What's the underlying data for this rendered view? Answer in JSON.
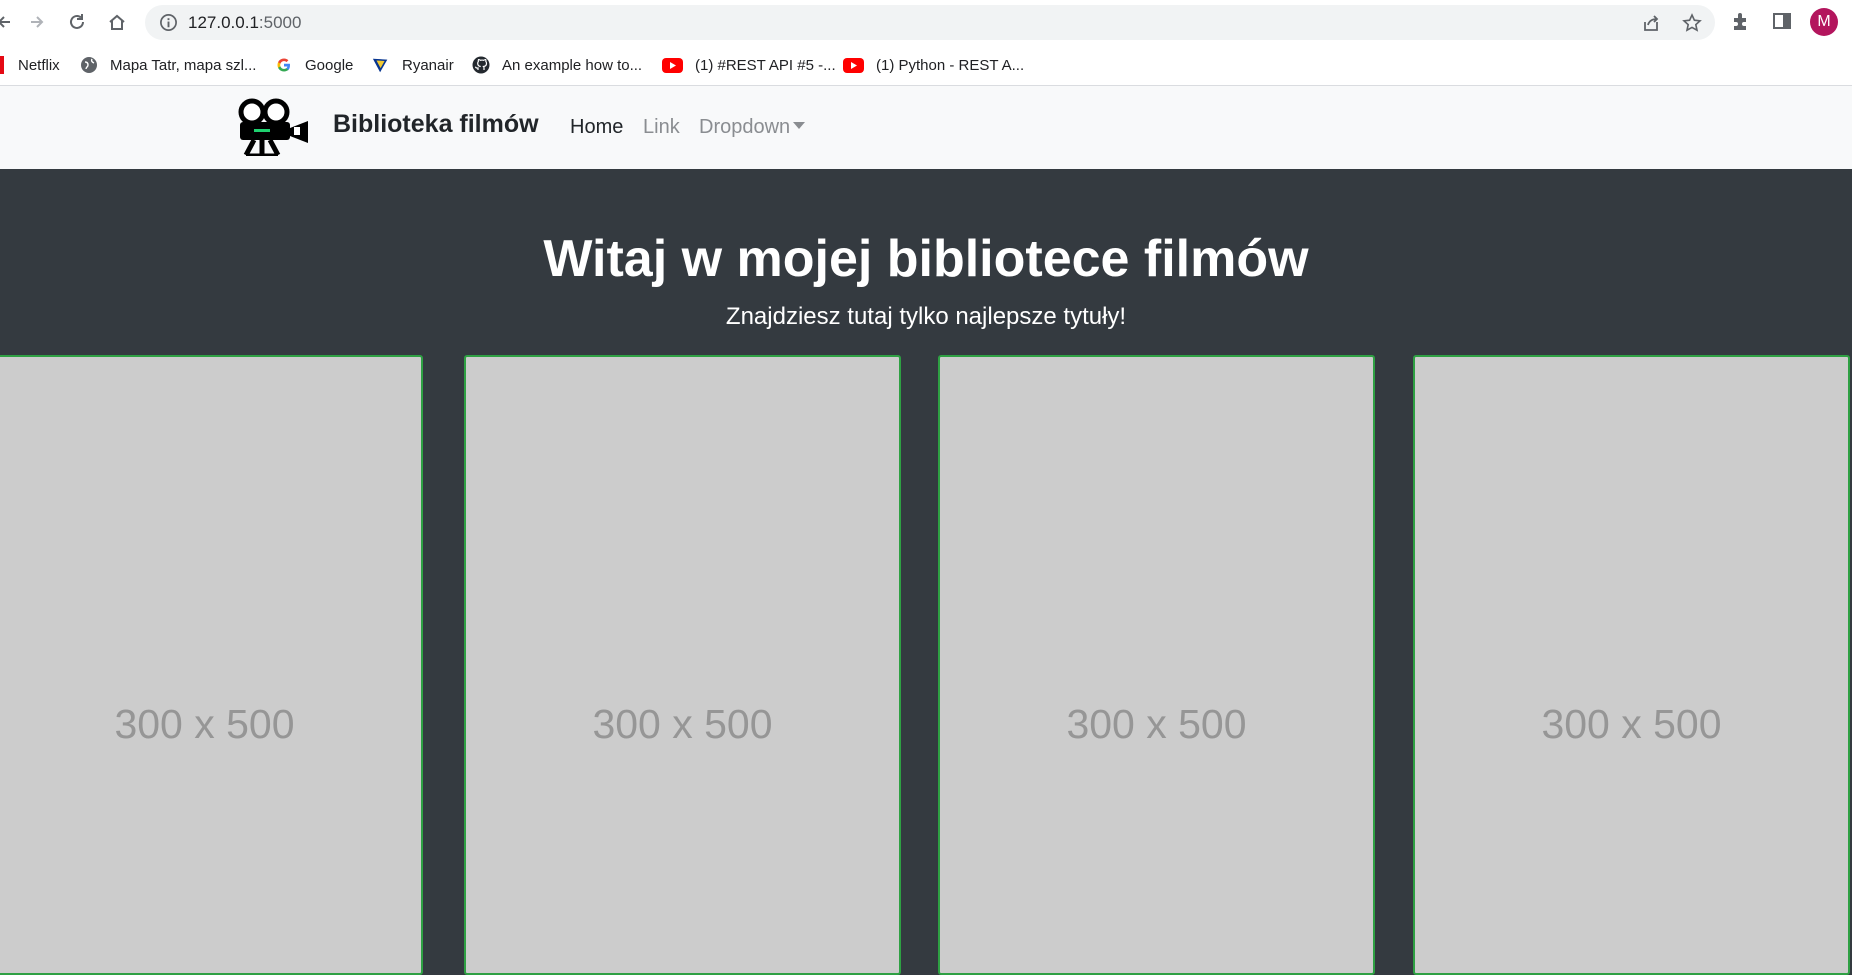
{
  "browser": {
    "url_host": "127.0.0.1",
    "url_port": ":5000",
    "avatar_letter": "M",
    "bookmarks": [
      {
        "label": "Netflix",
        "icon": "netflix-icon"
      },
      {
        "label": "Mapa Tatr, mapa szl...",
        "icon": "globe-icon"
      },
      {
        "label": "Google",
        "icon": "google-icon"
      },
      {
        "label": "Ryanair",
        "icon": "ryanair-icon"
      },
      {
        "label": "An example how to...",
        "icon": "github-icon"
      },
      {
        "label": "(1) #REST API #5 -...",
        "icon": "youtube-icon"
      },
      {
        "label": "(1) Python - REST A...",
        "icon": "youtube-icon"
      }
    ]
  },
  "navbar": {
    "brand": "Biblioteka filmów",
    "links": {
      "home": "Home",
      "link": "Link",
      "dropdown": "Dropdown"
    }
  },
  "hero": {
    "title": "Witaj w mojej bibliotece filmów",
    "subtitle": "Znajdziesz tutaj tylko najlepsze tytuły!"
  },
  "cards": [
    {
      "placeholder": "300 x 500"
    },
    {
      "placeholder": "300 x 500"
    },
    {
      "placeholder": "300 x 500"
    },
    {
      "placeholder": "300 x 500"
    }
  ],
  "colors": {
    "hero_bg": "#343a40",
    "navbar_bg": "#f8f9fa",
    "card_border": "#2ea043",
    "placeholder_bg": "#cccccc"
  }
}
